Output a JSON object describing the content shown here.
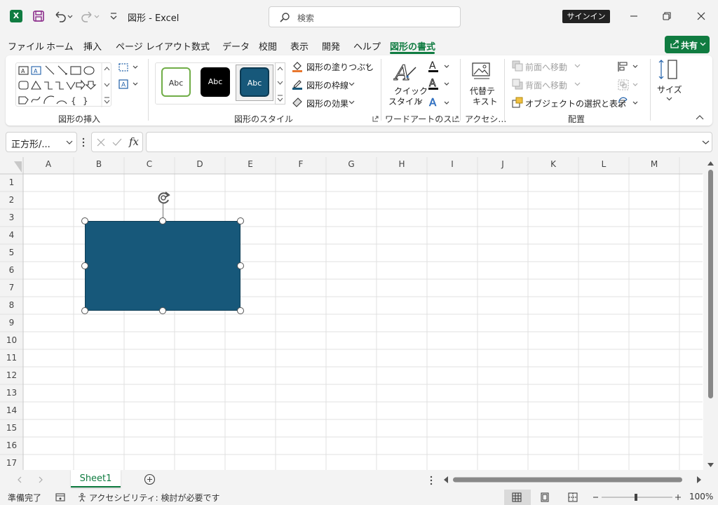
{
  "window": {
    "title": "図形  -  Excel",
    "search_placeholder": "検索",
    "signin_label": "サインイン"
  },
  "menu": {
    "tabs": [
      "ファイル",
      "ホーム",
      "挿入",
      "ページ レイアウト",
      "数式",
      "データ",
      "校閲",
      "表示",
      "開発",
      "ヘルプ",
      "図形の書式"
    ],
    "active_tab": "図形の書式",
    "share_label": "共有"
  },
  "ribbon": {
    "insert_shapes": {
      "label": "図形の挿入"
    },
    "shape_styles": {
      "label": "図形のスタイル",
      "thumbs": [
        "Abc",
        "Abc",
        "Abc"
      ],
      "fill_label": "図形の塗りつぶし",
      "outline_label": "図形の枠線",
      "effects_label": "図形の効果"
    },
    "wordart": {
      "label": "ワードアートのス…",
      "quick_style_line1": "クイック",
      "quick_style_line2": "スタイル"
    },
    "accessibility": {
      "label": "アクセシ…",
      "alt_text_line1": "代替テ",
      "alt_text_line2": "キスト"
    },
    "arrange": {
      "label": "配置",
      "bring_forward": "前面へ移動",
      "send_backward": "背面へ移動",
      "selection_pane": "オブジェクトの選択と表示"
    },
    "size": {
      "label": "サイズ"
    }
  },
  "formula_bar": {
    "name_box": "正方形/...",
    "fx": "fx",
    "formula": ""
  },
  "grid": {
    "columns": [
      "A",
      "B",
      "C",
      "D",
      "E",
      "F",
      "G",
      "H",
      "I",
      "J",
      "K",
      "L",
      "M"
    ],
    "rows": [
      "1",
      "2",
      "3",
      "4",
      "5",
      "6",
      "7",
      "8",
      "9",
      "10",
      "11",
      "12",
      "13",
      "14",
      "15",
      "16",
      "17"
    ],
    "shape_fill": "#17587a",
    "accent": "#107c41"
  },
  "sheets": {
    "tabs": [
      "Sheet1"
    ],
    "active": "Sheet1"
  },
  "status_bar": {
    "ready": "準備完了",
    "accessibility": "アクセシビリティ: 検討が必要です",
    "zoom": "100%"
  }
}
